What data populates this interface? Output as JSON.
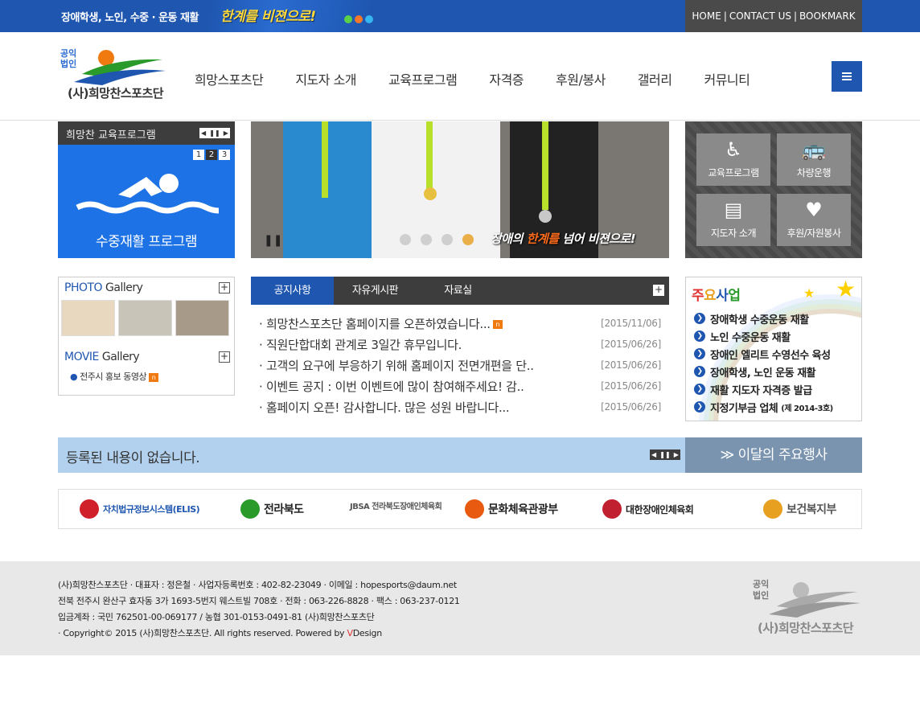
{
  "topbar": {
    "slogan": "장애학생, 노인, 수중 · 운동 재활",
    "highlight": "한계를 비젼으로!",
    "util_links": [
      "HOME",
      "CONTACT US",
      "BOOKMARK"
    ]
  },
  "logo": {
    "badge_line1": "공익",
    "badge_line2": "법인",
    "name": "(사)희망찬스포츠단"
  },
  "gnb": [
    "희망스포츠단",
    "지도자 소개",
    "교육프로그램",
    "자격증",
    "후원/봉사",
    "갤러리",
    "커뮤니티"
  ],
  "program": {
    "title": "희망찬 교육프로그램",
    "pages": [
      "1",
      "2",
      "3"
    ],
    "active_page": "2",
    "caption": "수중재활 프로그램"
  },
  "visual": {
    "caption_prefix": "장애의 ",
    "caption_highlight": "한계를",
    "caption_suffix": " 넘어 비젼으로!"
  },
  "quick": [
    {
      "label": "교육프로그램",
      "icon": "wheelchair-icon"
    },
    {
      "label": "차량운행",
      "icon": "bus-icon"
    },
    {
      "label": "지도자 소개",
      "icon": "documents-icon"
    },
    {
      "label": "후원/자원봉사",
      "icon": "heart-icon"
    }
  ],
  "gallery": {
    "photo_title_accent": "PHOTO",
    "photo_title_rest": " Gallery",
    "movie_title_accent": "MOVIE",
    "movie_title_rest": " Gallery",
    "movie_item": "전주시 홍보 동영상"
  },
  "board": {
    "tabs": [
      "공지사항",
      "자유게시판",
      "자료실"
    ],
    "posts": [
      {
        "title": "희망찬스포츠단 홈페이지를 오픈하였습니다...",
        "date": "[2015/11/06]",
        "is_new": true
      },
      {
        "title": "직원단합대회 관계로 3일간 휴무입니다.",
        "date": "[2015/06/26]",
        "is_new": false
      },
      {
        "title": "고객의 요구에 부응하기 위해 홈페이지 전면개편을 단..",
        "date": "[2015/06/26]",
        "is_new": false
      },
      {
        "title": "이벤트 공지 : 이번 이벤트에 많이 참여해주세요! 감..",
        "date": "[2015/06/26]",
        "is_new": false
      },
      {
        "title": "홈페이지 오픈! 감사합니다. 많은 성원 바랍니다...",
        "date": "[2015/06/26]",
        "is_new": false
      }
    ]
  },
  "business": {
    "title_chars": [
      "주",
      "요",
      "사",
      "업"
    ],
    "items": [
      {
        "text": "장애학생 수중운동 재활",
        "note": ""
      },
      {
        "text": "노인 수중운동 재활",
        "note": ""
      },
      {
        "text": "장애인 엘리트 수영선수 육성",
        "note": ""
      },
      {
        "text": "장애학생, 노인 운동 재활",
        "note": ""
      },
      {
        "text": "재활 지도자 자격증 발급",
        "note": ""
      },
      {
        "text": "지정기부금 업체",
        "note": "(제 2014-3호)"
      }
    ]
  },
  "events": {
    "empty_text": "등록된 내용이 없습니다.",
    "button": "이달의 주요행사"
  },
  "partners": [
    {
      "name": "자치법규정보시스템(ELIS)",
      "color": "#d0202a"
    },
    {
      "name": "전라북도",
      "color": "#2a9a2a"
    },
    {
      "name": "JBSA 전라북도장애인체육회",
      "color": "#1e56b0"
    },
    {
      "name": "문화체육관광부",
      "color": "#e85a10"
    },
    {
      "name": "대한장애인체육회",
      "color": "#c02030"
    },
    {
      "name": "보건복지부",
      "color": "#e8a020"
    }
  ],
  "footer": {
    "line1": "(사)희망찬스포츠단  · 대표자 : 정은철  · 사업자등록번호 : 402-82-23049  · 이메일 : hopesports@daum.net",
    "line2": "전북 전주시 완산구 효자동 3가 1693-5번지 웨스트빌 708호  · 전화 : 063-226-8828  · 팩스 : 063-237-0121",
    "line3": "입금계좌 : 국민 762501-00-069177 / 농협 301-0153-0491-81 (사)희망찬스포츠단",
    "copyright_prefix": " · Copyright© 2015 (사)희망찬스포츠단. All rights reserved. Powered by ",
    "copyright_brand": "V",
    "copyright_suffix": "Design",
    "logo_badge1": "공익",
    "logo_badge2": "법인",
    "logo_name": "(사)희망찬스포츠단"
  },
  "colors": {
    "primary": "#1e56b0",
    "dark": "#3d3d3d",
    "accent_orange": "#f07a10"
  }
}
